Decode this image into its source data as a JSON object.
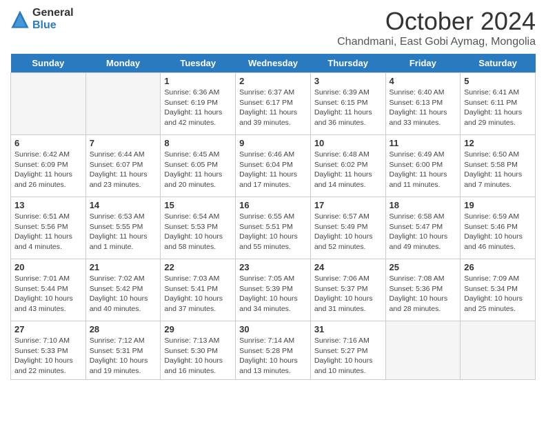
{
  "header": {
    "logo_general": "General",
    "logo_blue": "Blue",
    "month": "October 2024",
    "location": "Chandmani, East Gobi Aymag, Mongolia"
  },
  "weekdays": [
    "Sunday",
    "Monday",
    "Tuesday",
    "Wednesday",
    "Thursday",
    "Friday",
    "Saturday"
  ],
  "weeks": [
    [
      {
        "day": "",
        "info": ""
      },
      {
        "day": "",
        "info": ""
      },
      {
        "day": "1",
        "info": "Sunrise: 6:36 AM\nSunset: 6:19 PM\nDaylight: 11 hours and 42 minutes."
      },
      {
        "day": "2",
        "info": "Sunrise: 6:37 AM\nSunset: 6:17 PM\nDaylight: 11 hours and 39 minutes."
      },
      {
        "day": "3",
        "info": "Sunrise: 6:39 AM\nSunset: 6:15 PM\nDaylight: 11 hours and 36 minutes."
      },
      {
        "day": "4",
        "info": "Sunrise: 6:40 AM\nSunset: 6:13 PM\nDaylight: 11 hours and 33 minutes."
      },
      {
        "day": "5",
        "info": "Sunrise: 6:41 AM\nSunset: 6:11 PM\nDaylight: 11 hours and 29 minutes."
      }
    ],
    [
      {
        "day": "6",
        "info": "Sunrise: 6:42 AM\nSunset: 6:09 PM\nDaylight: 11 hours and 26 minutes."
      },
      {
        "day": "7",
        "info": "Sunrise: 6:44 AM\nSunset: 6:07 PM\nDaylight: 11 hours and 23 minutes."
      },
      {
        "day": "8",
        "info": "Sunrise: 6:45 AM\nSunset: 6:05 PM\nDaylight: 11 hours and 20 minutes."
      },
      {
        "day": "9",
        "info": "Sunrise: 6:46 AM\nSunset: 6:04 PM\nDaylight: 11 hours and 17 minutes."
      },
      {
        "day": "10",
        "info": "Sunrise: 6:48 AM\nSunset: 6:02 PM\nDaylight: 11 hours and 14 minutes."
      },
      {
        "day": "11",
        "info": "Sunrise: 6:49 AM\nSunset: 6:00 PM\nDaylight: 11 hours and 11 minutes."
      },
      {
        "day": "12",
        "info": "Sunrise: 6:50 AM\nSunset: 5:58 PM\nDaylight: 11 hours and 7 minutes."
      }
    ],
    [
      {
        "day": "13",
        "info": "Sunrise: 6:51 AM\nSunset: 5:56 PM\nDaylight: 11 hours and 4 minutes."
      },
      {
        "day": "14",
        "info": "Sunrise: 6:53 AM\nSunset: 5:55 PM\nDaylight: 11 hours and 1 minute."
      },
      {
        "day": "15",
        "info": "Sunrise: 6:54 AM\nSunset: 5:53 PM\nDaylight: 10 hours and 58 minutes."
      },
      {
        "day": "16",
        "info": "Sunrise: 6:55 AM\nSunset: 5:51 PM\nDaylight: 10 hours and 55 minutes."
      },
      {
        "day": "17",
        "info": "Sunrise: 6:57 AM\nSunset: 5:49 PM\nDaylight: 10 hours and 52 minutes."
      },
      {
        "day": "18",
        "info": "Sunrise: 6:58 AM\nSunset: 5:47 PM\nDaylight: 10 hours and 49 minutes."
      },
      {
        "day": "19",
        "info": "Sunrise: 6:59 AM\nSunset: 5:46 PM\nDaylight: 10 hours and 46 minutes."
      }
    ],
    [
      {
        "day": "20",
        "info": "Sunrise: 7:01 AM\nSunset: 5:44 PM\nDaylight: 10 hours and 43 minutes."
      },
      {
        "day": "21",
        "info": "Sunrise: 7:02 AM\nSunset: 5:42 PM\nDaylight: 10 hours and 40 minutes."
      },
      {
        "day": "22",
        "info": "Sunrise: 7:03 AM\nSunset: 5:41 PM\nDaylight: 10 hours and 37 minutes."
      },
      {
        "day": "23",
        "info": "Sunrise: 7:05 AM\nSunset: 5:39 PM\nDaylight: 10 hours and 34 minutes."
      },
      {
        "day": "24",
        "info": "Sunrise: 7:06 AM\nSunset: 5:37 PM\nDaylight: 10 hours and 31 minutes."
      },
      {
        "day": "25",
        "info": "Sunrise: 7:08 AM\nSunset: 5:36 PM\nDaylight: 10 hours and 28 minutes."
      },
      {
        "day": "26",
        "info": "Sunrise: 7:09 AM\nSunset: 5:34 PM\nDaylight: 10 hours and 25 minutes."
      }
    ],
    [
      {
        "day": "27",
        "info": "Sunrise: 7:10 AM\nSunset: 5:33 PM\nDaylight: 10 hours and 22 minutes."
      },
      {
        "day": "28",
        "info": "Sunrise: 7:12 AM\nSunset: 5:31 PM\nDaylight: 10 hours and 19 minutes."
      },
      {
        "day": "29",
        "info": "Sunrise: 7:13 AM\nSunset: 5:30 PM\nDaylight: 10 hours and 16 minutes."
      },
      {
        "day": "30",
        "info": "Sunrise: 7:14 AM\nSunset: 5:28 PM\nDaylight: 10 hours and 13 minutes."
      },
      {
        "day": "31",
        "info": "Sunrise: 7:16 AM\nSunset: 5:27 PM\nDaylight: 10 hours and 10 minutes."
      },
      {
        "day": "",
        "info": ""
      },
      {
        "day": "",
        "info": ""
      }
    ]
  ]
}
